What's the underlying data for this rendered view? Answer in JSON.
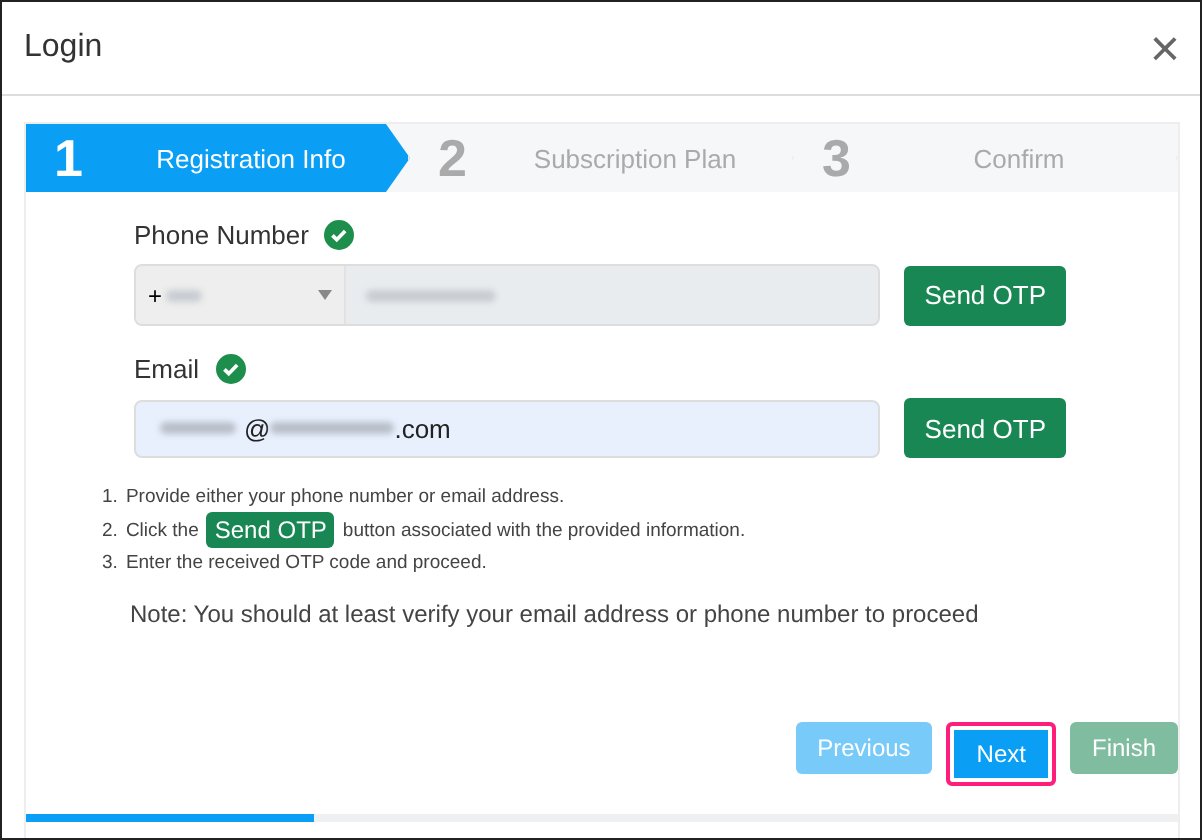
{
  "window": {
    "title": "Login",
    "close": "×"
  },
  "steps": [
    {
      "number": "1",
      "label": "Registration Info",
      "selected": true
    },
    {
      "number": "2",
      "label": "Subscription Plan",
      "selected": false
    },
    {
      "number": "3",
      "label": "Confirm",
      "selected": false
    }
  ],
  "phone": {
    "label": "Phone Number",
    "verified": true,
    "prefix": "+",
    "button": "Send OTP"
  },
  "email": {
    "label": "Email",
    "verified": true,
    "value_parts": [
      "@",
      ".com"
    ],
    "button": "Send OTP"
  },
  "instructions": [
    {
      "number": "1.",
      "before": "Provide either your phone number or email address."
    },
    {
      "number": "2.",
      "before": "Click the",
      "badge": "Send OTP",
      "after": "button associated with the provided information."
    },
    {
      "number": "3.",
      "before": "Enter the received OTP code and proceed."
    }
  ],
  "note": "Note: You should at least verify your email address or phone number to proceed",
  "buttons": [
    {
      "label": "Previous",
      "kind": "previous",
      "disabled": true,
      "highlighted": false
    },
    {
      "label": "Next",
      "kind": "next",
      "disabled": false,
      "highlighted": true
    },
    {
      "label": "Finish",
      "kind": "finish",
      "disabled": true,
      "highlighted": false
    }
  ],
  "progress": {
    "level": 0.25
  }
}
